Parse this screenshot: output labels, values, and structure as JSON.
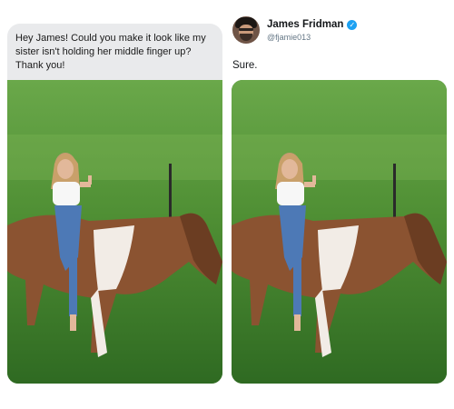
{
  "request": {
    "text": "Hey James! Could you make it look like my sister isn't holding her middle finger up? Thank you!"
  },
  "author": {
    "display_name": "James Fridman",
    "handle": "@fjamie013",
    "verified_icon": "verified-badge-icon",
    "avatar": "profile-photo"
  },
  "reply": {
    "text": "Sure."
  },
  "photos": [
    {
      "name": "original-photo",
      "description_icon": "photo-girl-on-horse-left"
    },
    {
      "name": "edited-photo",
      "description_icon": "photo-girl-on-horse-right"
    }
  ],
  "colors": {
    "bubble_bg": "#e9eaec",
    "verified": "#1da1f2",
    "grass": "#4f8f34",
    "horse_brown": "#8b5331",
    "jeans": "#4d79b6"
  }
}
